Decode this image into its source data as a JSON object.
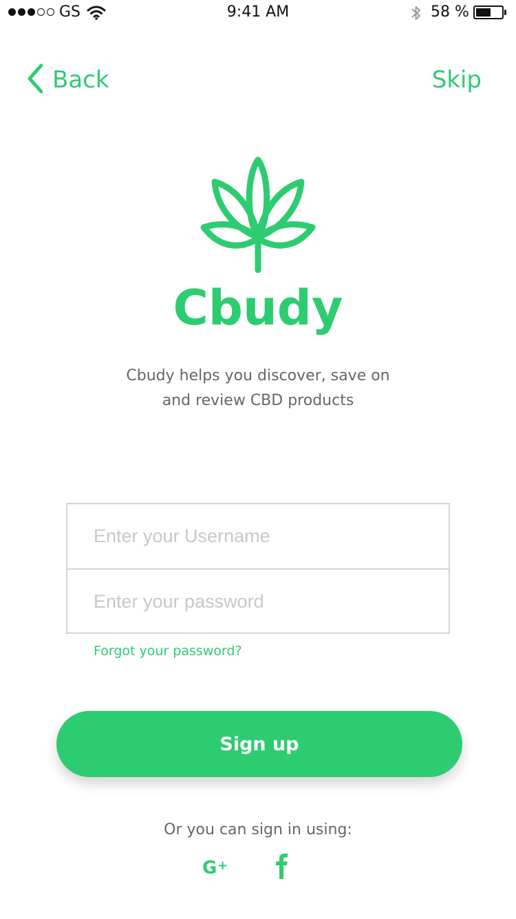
{
  "status_bar": {
    "carrier": "GS",
    "time": "9:41 AM",
    "battery_percent": "58 %",
    "signal_filled_dots": 3,
    "signal_total_dots": 5,
    "battery_level": 0.58
  },
  "nav": {
    "back_label": "Back",
    "skip_label": "Skip"
  },
  "brand": {
    "name": "Cbudy",
    "tagline_line1": "Cbudy helps you discover, save on",
    "tagline_line2": "and review CBD products",
    "logo_icon": "cannabis-leaf-icon"
  },
  "form": {
    "username": {
      "value": "",
      "placeholder": "Enter your Username"
    },
    "password": {
      "value": "",
      "placeholder": "Enter your password"
    },
    "forgot_label": "Forgot your password?"
  },
  "signup_label": "Sign up",
  "alt_signin_label": "Or you can sign in using:",
  "social": [
    "google-plus-icon",
    "facebook-icon"
  ],
  "colors": {
    "accent": "#2ecc71",
    "text_muted": "#666666",
    "placeholder": "#c8c8c8",
    "border": "#d4d4d4"
  }
}
